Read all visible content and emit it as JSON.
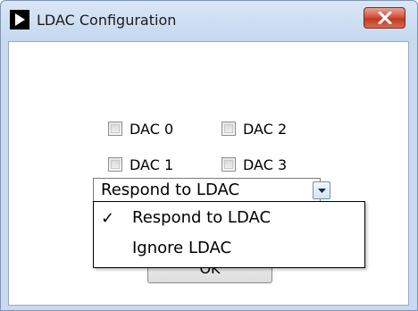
{
  "window": {
    "title": "LDAC Configuration",
    "close_icon": "close-icon"
  },
  "checkboxes": [
    {
      "label": "DAC 0",
      "checked": false
    },
    {
      "label": "DAC 2",
      "checked": false
    },
    {
      "label": "DAC 1",
      "checked": false
    },
    {
      "label": "DAC 3",
      "checked": false
    }
  ],
  "ldac_select": {
    "selected": "Respond to LDAC",
    "options": [
      {
        "label": "Respond to LDAC",
        "check": "✓"
      },
      {
        "label": "Ignore LDAC",
        "check": ""
      }
    ]
  },
  "ok_button": {
    "label": "OK"
  },
  "colors": {
    "close_button": "#c94a33",
    "title_bar": "#c9daf0"
  }
}
